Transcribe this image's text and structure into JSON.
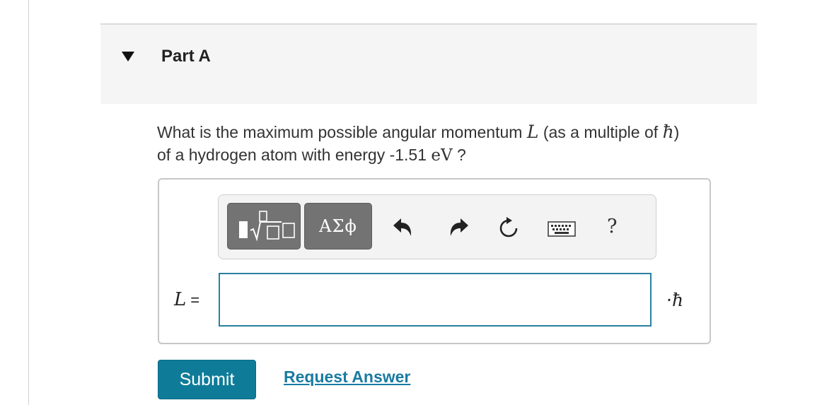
{
  "part": {
    "title": "Part A",
    "toggle_icon": "triangle-down-icon"
  },
  "question": {
    "prefix": "What is the maximum possible angular momentum",
    "symbol": "L",
    "middle": "(as a multiple of",
    "hbar": "ħ",
    "close": ")",
    "line2_prefix": "of a hydrogen atom with energy -1.51",
    "unit": "eV",
    "suffix": "?"
  },
  "toolbar": {
    "templates_icon": "templates-icon",
    "symbols_label": "ΑΣϕ",
    "undo_icon": "undo-icon",
    "redo_icon": "redo-icon",
    "reset_icon": "reset-icon",
    "keyboard_icon": "keyboard-icon",
    "help_label": "?"
  },
  "answer": {
    "variable": "L",
    "equals": "=",
    "value": "",
    "unit": "·ħ"
  },
  "actions": {
    "submit_label": "Submit",
    "request_label": "Request Answer"
  },
  "colors": {
    "accent": "#0e7c99",
    "link": "#1a7ba1",
    "input_border": "#2a7fa2",
    "header_bg": "#f5f5f5"
  }
}
